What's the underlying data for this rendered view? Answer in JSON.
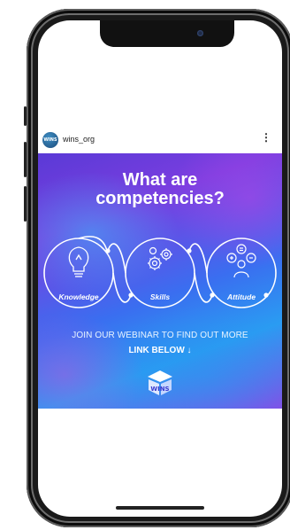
{
  "post": {
    "username": "wins_org",
    "more_icon": "⋮",
    "avatar_text": "WINS"
  },
  "graphic": {
    "headline_line1": "What are",
    "headline_line2": "competencies?",
    "competencies": [
      {
        "label": "Knowledge",
        "icon": "lightbulb-icon"
      },
      {
        "label": "Skills",
        "icon": "gears-icon"
      },
      {
        "label": "Attitude",
        "icon": "emotions-icon"
      }
    ],
    "cta_line1": "JOIN OUR WEBINAR TO FIND OUT MORE",
    "cta_line2": "LINK BELOW ↓",
    "logo_text": "WINS"
  },
  "colors": {
    "gradient_start": "#5a3ad6",
    "gradient_mid": "#3a6ef0",
    "gradient_end": "#8a4ae6",
    "text": "#ffffff"
  }
}
